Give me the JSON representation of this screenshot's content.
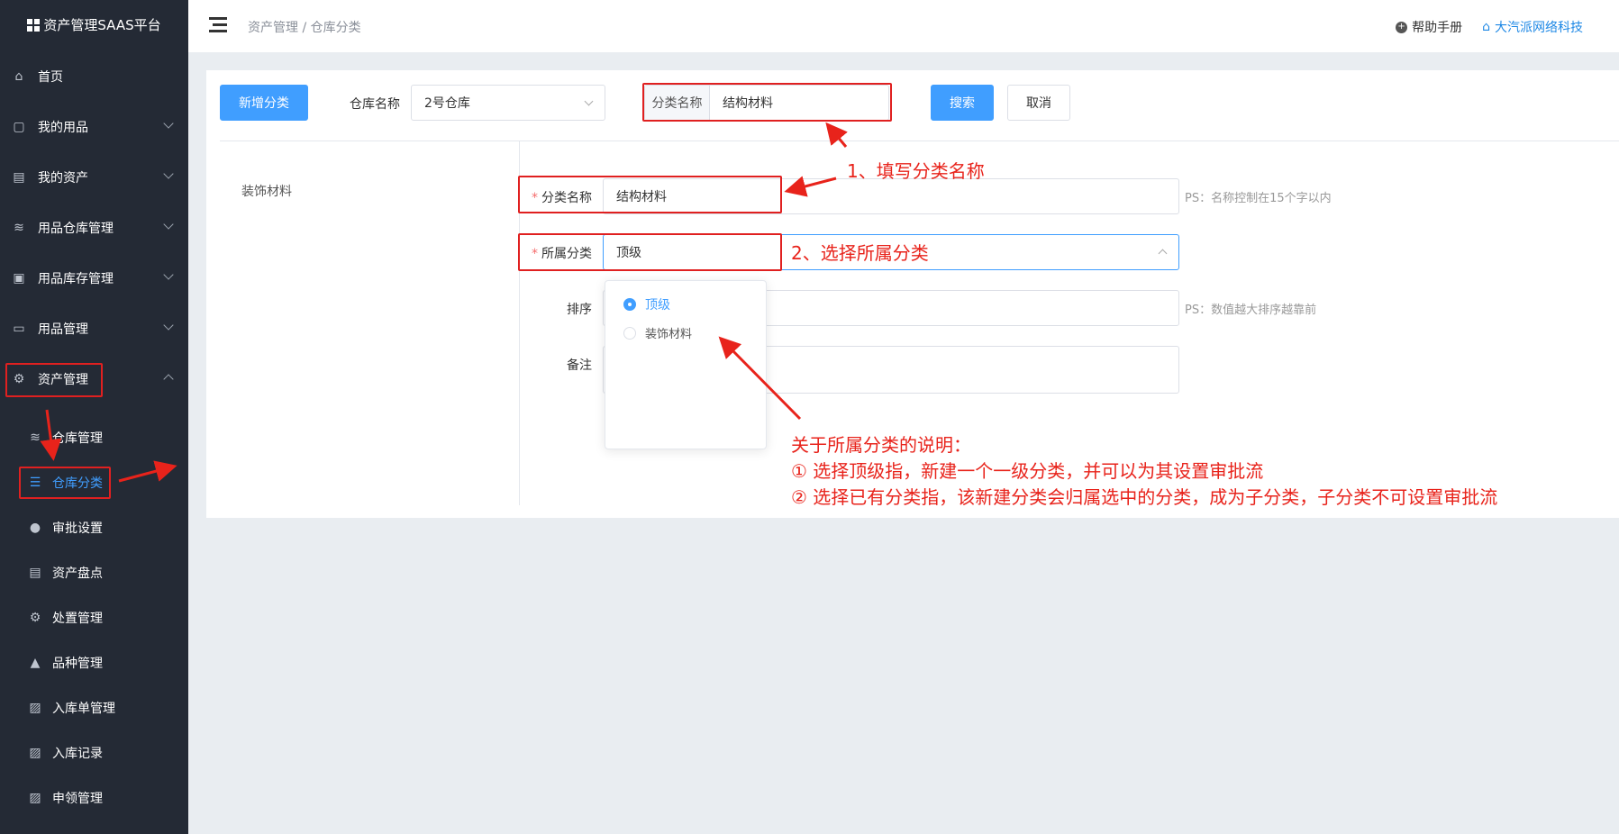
{
  "sidebar": {
    "brand": "资产管理SAAS平台",
    "items": [
      {
        "label": "首页",
        "icon": "home-icon"
      },
      {
        "label": "我的用品",
        "icon": "bag-icon"
      },
      {
        "label": "我的资产",
        "icon": "building-icon"
      },
      {
        "label": "用品仓库管理",
        "icon": "database-icon"
      },
      {
        "label": "用品库存管理",
        "icon": "box-icon"
      },
      {
        "label": "用品管理",
        "icon": "tray-icon"
      },
      {
        "label": "资产管理",
        "icon": "asset-icon"
      }
    ],
    "sub_items": [
      {
        "label": "仓库管理",
        "icon": "database-icon"
      },
      {
        "label": "仓库分类",
        "icon": "sliders-icon"
      },
      {
        "label": "审批设置",
        "icon": "user-icon"
      },
      {
        "label": "资产盘点",
        "icon": "doc-icon"
      },
      {
        "label": "处置管理",
        "icon": "gear-icon"
      },
      {
        "label": "品种管理",
        "icon": "lock-icon"
      },
      {
        "label": "入库单管理",
        "icon": "clipboard-check-icon"
      },
      {
        "label": "入库记录",
        "icon": "clipboard-icon"
      },
      {
        "label": "申领管理",
        "icon": "clipboard-icon"
      }
    ]
  },
  "header": {
    "breadcrumb": "资产管理 / 仓库分类",
    "help": "帮助手册",
    "company": "大汽派网络科技"
  },
  "toolbar": {
    "add_label": "新增分类",
    "warehouse_label": "仓库名称",
    "warehouse_value": "2号仓库",
    "category_prefix": "分类名称",
    "category_value": "结构材料",
    "search_label": "搜索",
    "cancel_label": "取消"
  },
  "tree": {
    "items": [
      "装饰材料"
    ]
  },
  "form": {
    "name_label": "分类名称",
    "name_value": "结构材料",
    "name_hint": "PS：名称控制在15个字以内",
    "parent_label": "所属分类",
    "parent_value": "顶级",
    "sort_label": "排序",
    "sort_hint": "PS：数值越大排序越靠前",
    "remark_label": "备注"
  },
  "dropdown": {
    "options": [
      {
        "label": "顶级",
        "selected": true
      },
      {
        "label": "装饰材料",
        "selected": false
      }
    ]
  },
  "annotations": {
    "step1": "1、填写分类名称",
    "step2": "2、选择所属分类",
    "note_title": "关于所属分类的说明：",
    "note_line1": "① 选择顶级指，新建一个一级分类，并可以为其设置审批流",
    "note_line2": "② 选择已有分类指，该新建分类会归属选中的分类，成为子分类，子分类不可设置审批流"
  },
  "colors": {
    "sidebar_bg": "#242a35",
    "accent": "#409eff",
    "annotation_red": "#e8231b"
  }
}
